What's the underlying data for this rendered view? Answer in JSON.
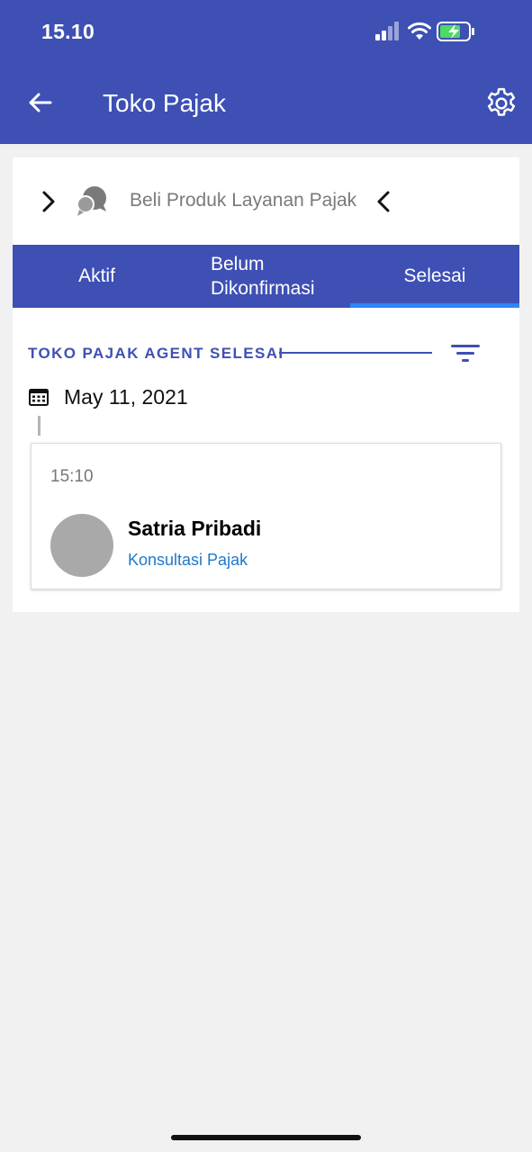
{
  "status_bar": {
    "time": "15.10"
  },
  "header": {
    "title": "Toko Pajak",
    "back_icon": "arrow-left-icon",
    "settings_icon": "gear-icon"
  },
  "product_selector": {
    "label": "Beli Produk Layanan Pajak"
  },
  "tabs": [
    {
      "label": "Aktif",
      "active": false
    },
    {
      "label": "Belum\nDikonfirmasi",
      "active": false
    },
    {
      "label": "Selesai",
      "active": true
    }
  ],
  "section": {
    "title": "TOKO PAJAK AGENT SELESAI"
  },
  "groups": [
    {
      "date": "May 11, 2021",
      "entries": [
        {
          "time": "15:10",
          "name": "Satria Pribadi",
          "service": "Konsultasi Pajak"
        }
      ]
    }
  ],
  "colors": {
    "primary": "#3e50b4",
    "tab_indicator": "#2f86f5",
    "link": "#1f78c8",
    "background": "#f1f1f1"
  }
}
